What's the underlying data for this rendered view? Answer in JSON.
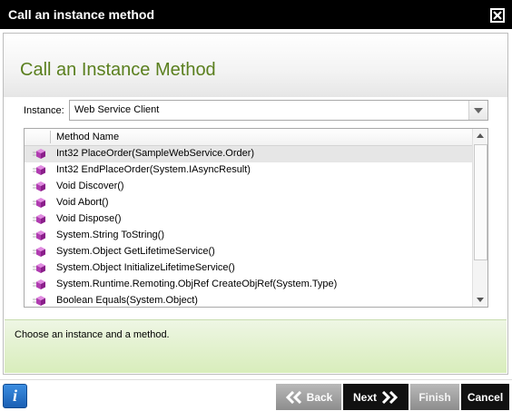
{
  "window": {
    "title": "Call an instance method"
  },
  "page": {
    "heading": "Call an Instance Method"
  },
  "instance": {
    "label": "Instance:",
    "value": "Web Service Client"
  },
  "methods": {
    "column_header": "Method Name",
    "items": [
      "Int32 PlaceOrder(SampleWebService.Order)",
      "Int32 EndPlaceOrder(System.IAsyncResult)",
      "Void Discover()",
      "Void Abort()",
      "Void Dispose()",
      "System.String ToString()",
      "System.Object GetLifetimeService()",
      "System.Object InitializeLifetimeService()",
      "System.Runtime.Remoting.ObjRef CreateObjRef(System.Type)",
      "Boolean Equals(System.Object)"
    ]
  },
  "info": {
    "message": "Choose an instance and a method."
  },
  "footer": {
    "info_icon": "i",
    "back_label": "Back",
    "next_label": "Next",
    "finish_label": "Finish",
    "cancel_label": "Cancel"
  },
  "colors": {
    "accent": "#5a7f1e",
    "title_bar": "#000000",
    "info_bg": "#e3f1cf"
  }
}
